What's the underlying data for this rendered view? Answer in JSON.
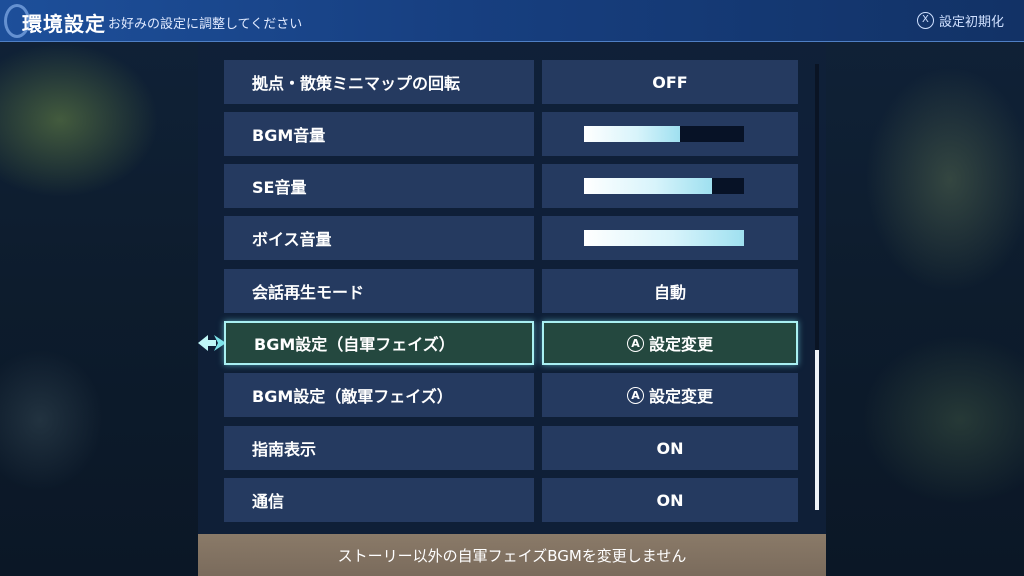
{
  "header": {
    "title": "環境設定",
    "subtitle": "お好みの設定に調整してください",
    "reset_button_key": "X",
    "reset_label": "設定初期化"
  },
  "settings": [
    {
      "label": "拠点・散策ミニマップの回転",
      "value": "OFF"
    },
    {
      "label": "BGM音量",
      "level": 0.6
    },
    {
      "label": "SE音量",
      "level": 0.8
    },
    {
      "label": "ボイス音量",
      "level": 1.0
    },
    {
      "label": "会話再生モード",
      "value": "自動"
    },
    {
      "label": "BGM設定（自軍フェイズ）",
      "button_key": "A",
      "value": "設定変更",
      "selected": true
    },
    {
      "label": "BGM設定（敵軍フェイズ）",
      "button_key": "A",
      "value": "設定変更"
    },
    {
      "label": "指南表示",
      "value": "ON"
    },
    {
      "label": "通信",
      "value": "ON"
    }
  ],
  "footer": {
    "description": "ストーリー以外の自軍フェイズBGMを変更しません"
  },
  "scrollbar": {
    "position": 0.64
  },
  "colors": {
    "header_bg": "#1d4f9a",
    "row_bg": "#253a60",
    "selected_bg": "#24483f",
    "selected_border": "#a9f0f2",
    "footer_bg": "#8a7a68"
  }
}
